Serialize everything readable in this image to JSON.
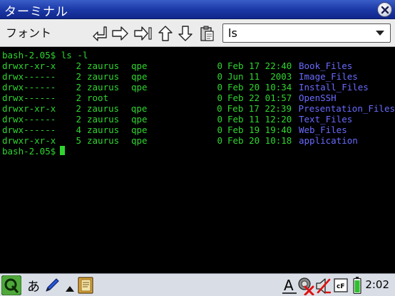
{
  "window": {
    "title": "ターミナル"
  },
  "toolbar": {
    "font_menu": "フォント",
    "command_combo": {
      "value": "ls"
    }
  },
  "terminal": {
    "prompt_line": "bash-2.05$ ls -l",
    "listing": [
      {
        "perm": "drwxr-xr-x",
        "links": "2",
        "owner": "zaurus",
        "group": "qpe",
        "size": "0",
        "date": "Feb 17 22:40",
        "name": "Book_Files"
      },
      {
        "perm": "drwx------",
        "links": "2",
        "owner": "zaurus",
        "group": "qpe",
        "size": "0",
        "date": "Jun 11  2003",
        "name": "Image_Files"
      },
      {
        "perm": "drwx------",
        "links": "2",
        "owner": "zaurus",
        "group": "qpe",
        "size": "0",
        "date": "Feb 20 10:34",
        "name": "Install_Files"
      },
      {
        "perm": "drwx------",
        "links": "2",
        "owner": "root",
        "group": "",
        "size": "0",
        "date": "Feb 22 01:57",
        "name": "OpenSSH"
      },
      {
        "perm": "drwxr-xr-x",
        "links": "2",
        "owner": "zaurus",
        "group": "qpe",
        "size": "0",
        "date": "Feb 17 22:39",
        "name": "Presentation_Files"
      },
      {
        "perm": "drwx------",
        "links": "2",
        "owner": "zaurus",
        "group": "qpe",
        "size": "0",
        "date": "Feb 11 12:20",
        "name": "Text_Files"
      },
      {
        "perm": "drwx------",
        "links": "4",
        "owner": "zaurus",
        "group": "qpe",
        "size": "0",
        "date": "Feb 19 19:40",
        "name": "Web_Files"
      },
      {
        "perm": "drwxr-xr-x",
        "links": "5",
        "owner": "zaurus",
        "group": "qpe",
        "size": "0",
        "date": "Feb 20 10:18",
        "name": "application"
      }
    ],
    "current_prompt": "bash-2.05$",
    "colors": {
      "text": "#2fd52f",
      "dir": "#6a6aff",
      "background": "#000000"
    }
  },
  "taskbar": {
    "ime_label": "あ",
    "clock": "2:02",
    "icons": [
      "qtopia-start-icon",
      "pen-icon",
      "notes-icon",
      "ime-a-icon",
      "network-disconnected-icon",
      "volume-muted-icon",
      "cf-card-icon",
      "battery-icon"
    ]
  }
}
